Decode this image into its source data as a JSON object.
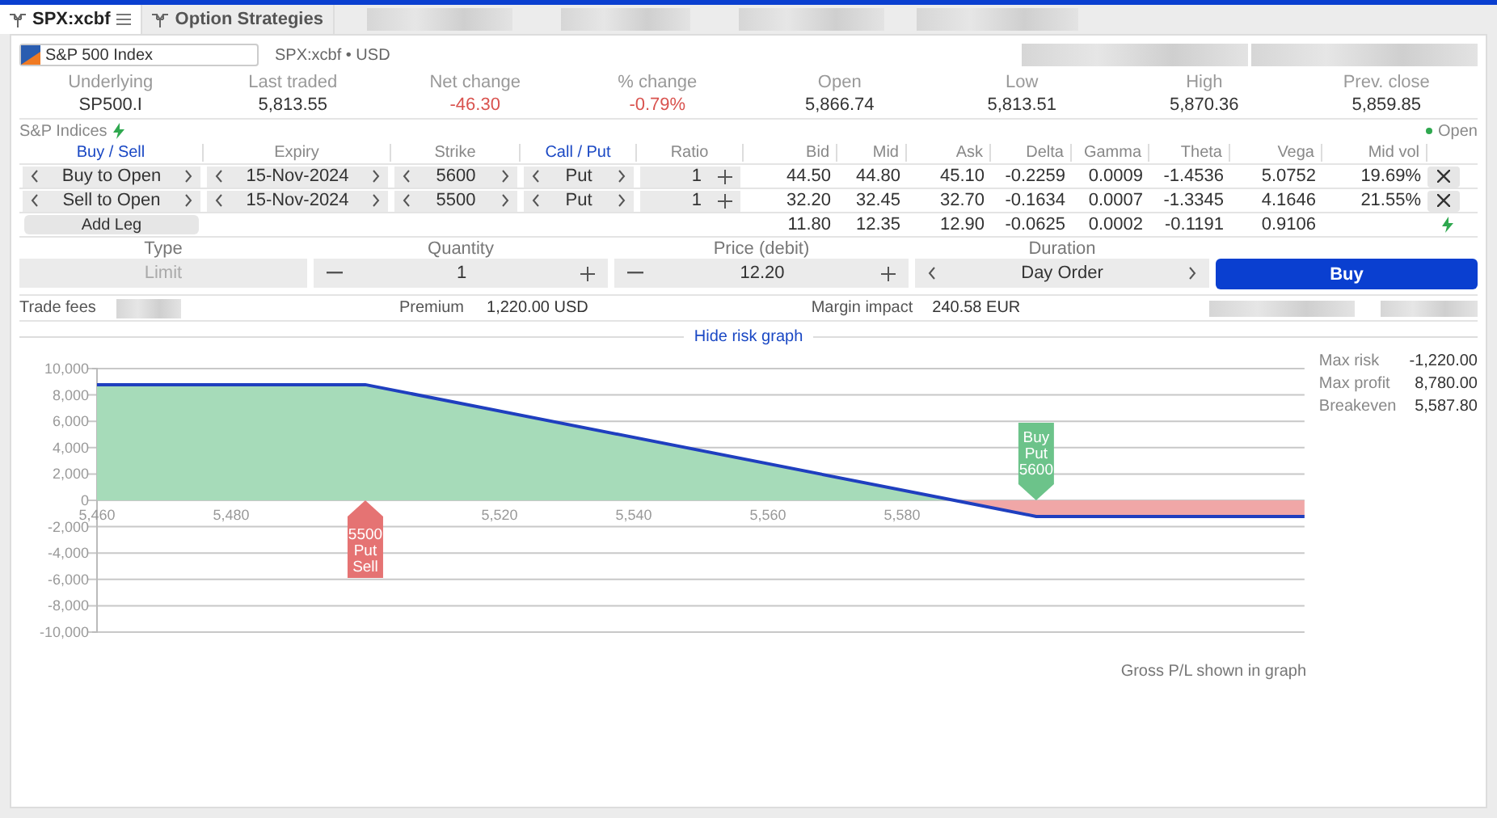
{
  "tabs": [
    {
      "label": "SPX:xcbf",
      "selected": true,
      "menu": true
    },
    {
      "label": "Option Strategies",
      "selected": false,
      "menu": false
    }
  ],
  "instrument": {
    "name": "S&P 500 Index",
    "info": "SPX:xcbf • USD"
  },
  "quote": [
    {
      "label": "Underlying",
      "value": "SP500.I",
      "negative": false
    },
    {
      "label": "Last traded",
      "value": "5,813.55",
      "negative": false
    },
    {
      "label": "Net change",
      "value": "-46.30",
      "negative": true
    },
    {
      "label": "% change",
      "value": "-0.79%",
      "negative": true
    },
    {
      "label": "Open",
      "value": "5,866.74",
      "negative": false
    },
    {
      "label": "Low",
      "value": "5,813.51",
      "negative": false
    },
    {
      "label": "High",
      "value": "5,870.36",
      "negative": false
    },
    {
      "label": "Prev. close",
      "value": "5,859.85",
      "negative": false
    }
  ],
  "exchange": {
    "label": "S&P Indices",
    "status": "Open",
    "open": true
  },
  "legs_table": {
    "columns": [
      {
        "label": "Buy / Sell",
        "link": true
      },
      {
        "label": "Expiry",
        "link": false
      },
      {
        "label": "Strike",
        "link": false
      },
      {
        "label": "Call / Put",
        "link": true
      },
      {
        "label": "Ratio",
        "link": false
      },
      {
        "label": "Bid",
        "link": false
      },
      {
        "label": "Mid",
        "link": false
      },
      {
        "label": "Ask",
        "link": false
      },
      {
        "label": "Delta",
        "link": false
      },
      {
        "label": "Gamma",
        "link": false
      },
      {
        "label": "Theta",
        "link": false
      },
      {
        "label": "Vega",
        "link": false
      },
      {
        "label": "Mid vol",
        "link": false
      }
    ],
    "rows": [
      {
        "kind": "buy",
        "side": "Buy to Open",
        "expiry": "15-Nov-2024",
        "strike": "5600",
        "type": "Put",
        "ratio": "1",
        "bid": "44.50",
        "mid": "44.80",
        "ask": "45.10",
        "delta": "-0.2259",
        "gamma": "0.0009",
        "theta": "-1.4536",
        "vega": "5.0752",
        "mid_vol": "19.69%"
      },
      {
        "kind": "sell",
        "side": "Sell to Open",
        "expiry": "15-Nov-2024",
        "strike": "5500",
        "type": "Put",
        "ratio": "1",
        "bid": "32.20",
        "mid": "32.45",
        "ask": "32.70",
        "delta": "-0.1634",
        "gamma": "0.0007",
        "theta": "-1.3345",
        "vega": "4.1646",
        "mid_vol": "21.55%"
      }
    ],
    "total": {
      "bid": "11.80",
      "mid": "12.35",
      "ask": "12.90",
      "delta": "-0.0625",
      "gamma": "0.0002",
      "theta": "-0.1191",
      "vega": "0.9106"
    },
    "add_leg": "Add Leg"
  },
  "order": {
    "type": {
      "label": "Type",
      "value": "Limit",
      "disabled": true
    },
    "quantity": {
      "label": "Quantity",
      "value": "1"
    },
    "price": {
      "label": "Price (debit)",
      "value": "12.20"
    },
    "duration": {
      "label": "Duration",
      "value": "Day Order"
    },
    "submit": "Buy"
  },
  "costs": {
    "fees_label": "Trade fees",
    "premium_label": "Premium",
    "premium": "1,220.00 USD",
    "margin_label": "Margin impact",
    "margin": "240.58 EUR"
  },
  "risk_graph": {
    "toggle": "Hide risk graph",
    "chart_data": {
      "type": "line",
      "x": [
        5460,
        5500,
        5587.8,
        5600,
        5640
      ],
      "series": [
        {
          "color": "#1f3fbf",
          "values": [
            8780,
            8780,
            0,
            -1220,
            -1220
          ]
        }
      ],
      "xlim": [
        5460,
        5640
      ],
      "ylim": [
        -10000,
        10000
      ],
      "grid": true,
      "xticks": [
        {
          "value": 5460,
          "label": "5,460"
        },
        {
          "value": 5480,
          "label": "5,480"
        },
        {
          "value": 5520,
          "label": "5,520"
        },
        {
          "value": 5540,
          "label": "5,540"
        },
        {
          "value": 5560,
          "label": "5,560"
        },
        {
          "value": 5580,
          "label": "5,580"
        }
      ],
      "yticks": [
        {
          "value": 10000,
          "label": "10,000"
        },
        {
          "value": 8000,
          "label": "8,000"
        },
        {
          "value": 6000,
          "label": "6,000"
        },
        {
          "value": 4000,
          "label": "4,000"
        },
        {
          "value": 2000,
          "label": "2,000"
        },
        {
          "value": 0,
          "label": "0"
        },
        {
          "value": -2000,
          "label": "-2,000"
        },
        {
          "value": -4000,
          "label": "-4,000"
        },
        {
          "value": -6000,
          "label": "-6,000"
        },
        {
          "value": -8000,
          "label": "-8,000"
        },
        {
          "value": -10000,
          "label": "-10,000"
        }
      ],
      "annotations": [
        "Buy Put 5600",
        "5500 Put Sell"
      ]
    },
    "stats": [
      {
        "label": "Max risk",
        "value": "-1,220.00"
      },
      {
        "label": "Max profit",
        "value": "8,780.00"
      },
      {
        "label": "Breakeven",
        "value": "5,587.80"
      }
    ],
    "note": "Gross P/L shown in graph"
  }
}
